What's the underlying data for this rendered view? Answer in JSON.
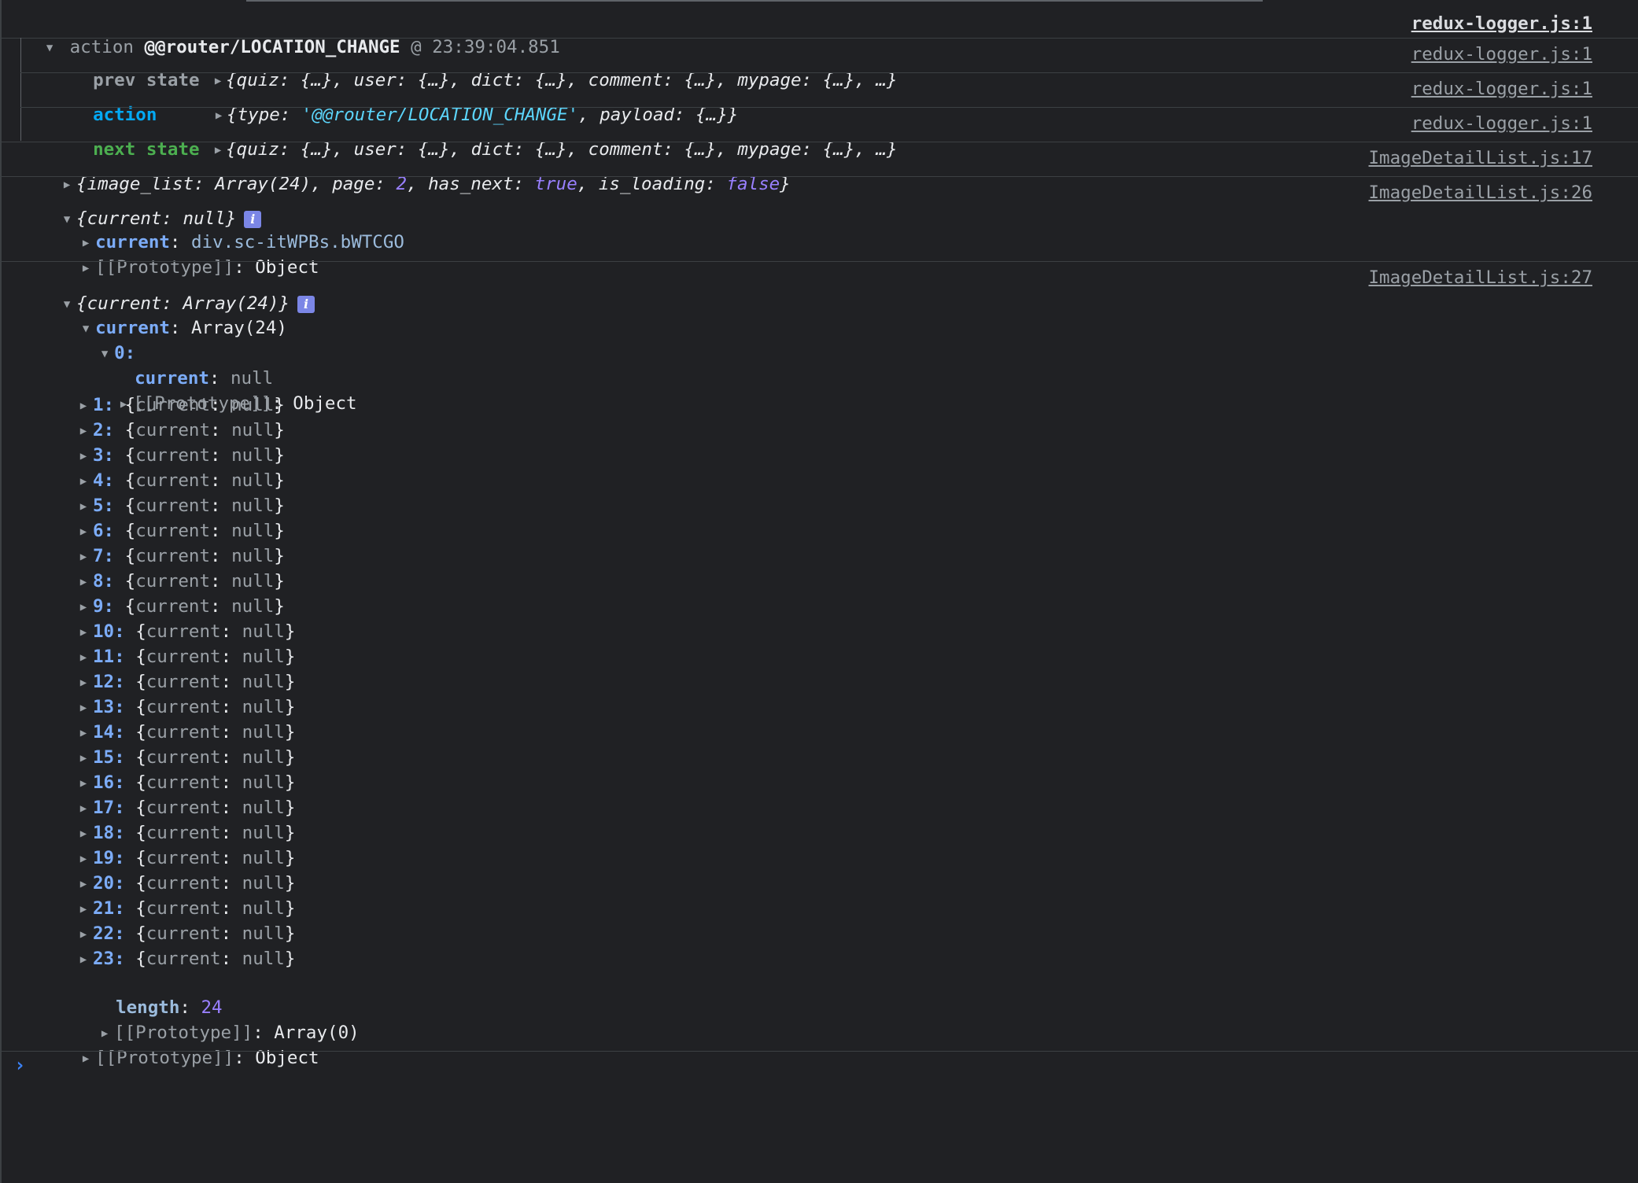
{
  "group": {
    "prefix": "action",
    "type": "@@router/LOCATION_CHANGE",
    "time": "@ 23:39:04.851",
    "source": "redux-logger.js:1"
  },
  "logger_rows": [
    {
      "label": "prev state",
      "content": "{quiz: {…}, user: {…}, dict: {…}, comment: {…}, mypage: {…}, …}",
      "source": "redux-logger.js:1"
    },
    {
      "label": "action",
      "content_pre": "{type: ",
      "content_str": "'@@router/LOCATION_CHANGE'",
      "content_post": ", payload: {…}}",
      "source": "redux-logger.js:1"
    },
    {
      "label": "next state",
      "content": "{quiz: {…}, user: {…}, dict: {…}, comment: {…}, mypage: {…}, …}",
      "source": "redux-logger.js:1"
    }
  ],
  "image_list_log": {
    "open": "{image_list: Array(24), page: ",
    "page": "2",
    "mid1": ", has_next: ",
    "has_next": "true",
    "mid2": ", is_loading: ",
    "is_loading": "false",
    "close": "}",
    "source": "ImageDetailList.js:17"
  },
  "ref_log": {
    "summary": "{current: null}",
    "source": "ImageDetailList.js:26",
    "current_key": "current",
    "current_value": "div.sc-itWPBs.bWTCGO",
    "proto_key": "[[Prototype]]",
    "proto_value": "Object"
  },
  "refs_log": {
    "summary": "{current: Array(24)}",
    "source": "ImageDetailList.js:27",
    "current_key": "current",
    "current_value": "Array(24)",
    "item0": {
      "index": "0",
      "current_key": "current",
      "current_value": "null",
      "proto_key": "[[Prototype]]",
      "proto_value": "Object"
    },
    "items": [
      {
        "index": "1"
      },
      {
        "index": "2"
      },
      {
        "index": "3"
      },
      {
        "index": "4"
      },
      {
        "index": "5"
      },
      {
        "index": "6"
      },
      {
        "index": "7"
      },
      {
        "index": "8"
      },
      {
        "index": "9"
      },
      {
        "index": "10"
      },
      {
        "index": "11"
      },
      {
        "index": "12"
      },
      {
        "index": "13"
      },
      {
        "index": "14"
      },
      {
        "index": "15"
      },
      {
        "index": "16"
      },
      {
        "index": "17"
      },
      {
        "index": "18"
      },
      {
        "index": "19"
      },
      {
        "index": "20"
      },
      {
        "index": "21"
      },
      {
        "index": "22"
      },
      {
        "index": "23"
      }
    ],
    "item_key": "current",
    "item_value": "null",
    "length_key": "length",
    "length_value": "24",
    "array_proto_key": "[[Prototype]]",
    "array_proto_value": "Array(0)",
    "proto_key": "[[Prototype]]",
    "proto_value": "Object"
  },
  "prompt_symbol": "›",
  "colors": {
    "background": "#202124",
    "key": "#7cacf8",
    "string": "#5cd5fb",
    "number": "#9980ff",
    "prev_state": "#9aa0a6",
    "action": "#03a9f4",
    "next_state": "#4caf50"
  }
}
